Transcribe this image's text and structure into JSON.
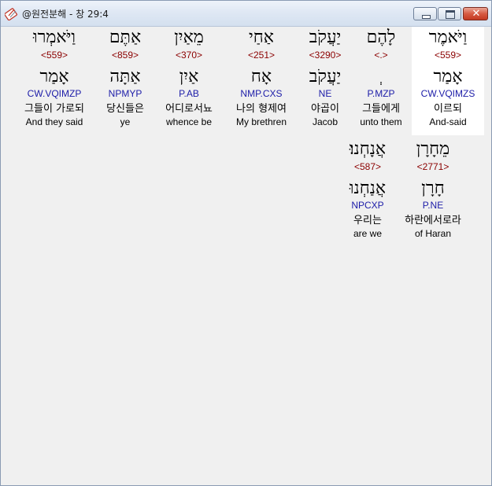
{
  "window": {
    "title": "@원전분해 - 창 29:4",
    "close_glyph": "✕"
  },
  "words": [
    {
      "heb": "וַיֹּאמֶר",
      "strong": "<559>",
      "lemma": "אָמַר",
      "morph": "CW.VQIMZS",
      "korean": "이르되",
      "english": "And-said",
      "selected": true
    },
    {
      "heb": "לָהֶם",
      "strong": "<.>",
      "lemma": "ְ",
      "morph": "P.MZP",
      "korean": "그들에게",
      "english": "unto them"
    },
    {
      "heb": "יַעֲקֹב",
      "strong": "<3290>",
      "lemma": "יַעֲקֹב",
      "morph": "NE",
      "korean": "야곱이",
      "english": "Jacob"
    },
    {
      "heb": "אַחַי",
      "strong": "<251>",
      "lemma": "אָח",
      "morph": "NMP.CXS",
      "korean": "나의 형제여",
      "english": "My brethren"
    },
    {
      "heb": "מֵאַיִן",
      "strong": "<370>",
      "lemma": "אַיִן",
      "morph": "P.AB",
      "korean": "어디로서뇨",
      "english": "whence be"
    },
    {
      "heb": "אַתֶּם",
      "strong": "<859>",
      "lemma": "אַתָּה",
      "morph": "NPMYP",
      "korean": "당신들은",
      "english": "ye"
    },
    {
      "heb": "וַיֹּאמְרוּ",
      "strong": "<559>",
      "lemma": "אָמַר",
      "morph": "CW.VQIMZP",
      "korean": "그들이 가로되",
      "english": "And they said"
    },
    {
      "heb": "מֵחָרָן",
      "strong": "<2771>",
      "lemma": "חָרָן",
      "morph": "P.NE",
      "korean": "하란에서로라",
      "english": "of Haran"
    },
    {
      "heb": "אֲנָחְנוּ׃",
      "strong": "<587>",
      "lemma": "אֲנַחְנוּ",
      "morph": "NPCXP",
      "korean": "우리는",
      "english": "are we"
    }
  ]
}
